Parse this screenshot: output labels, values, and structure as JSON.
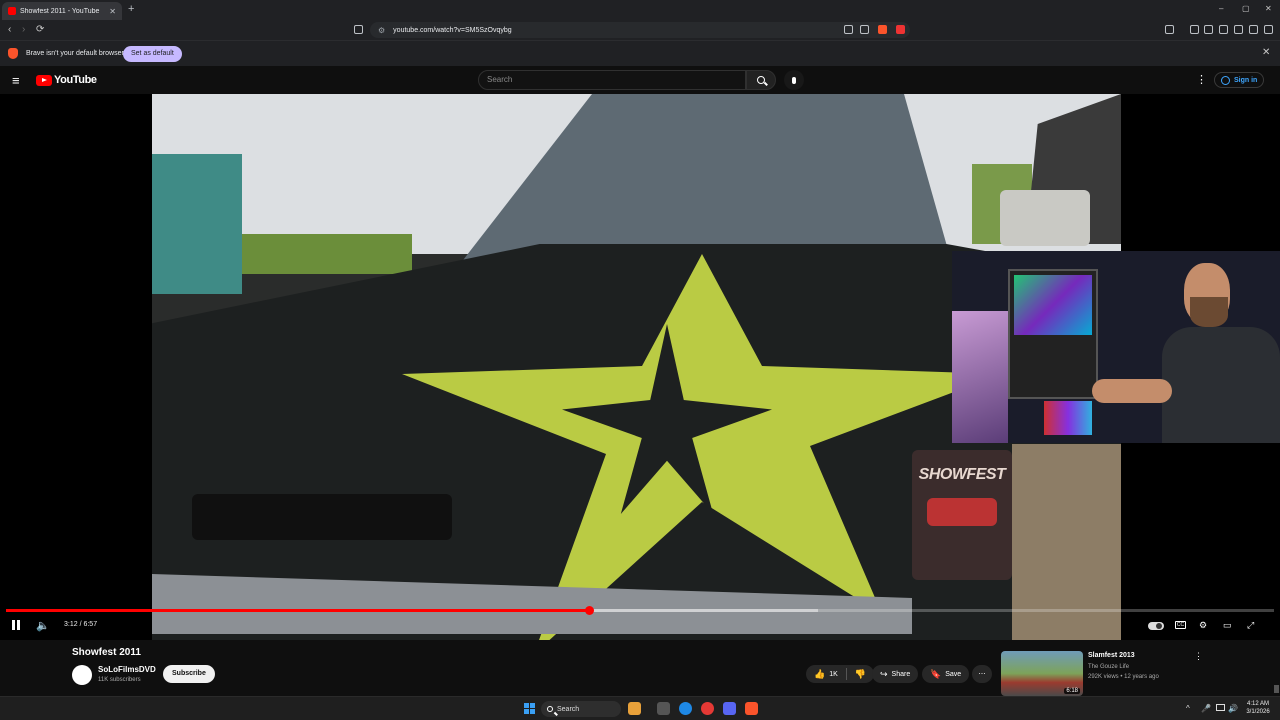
{
  "browser": {
    "tab_title": "Showfest 2011 - YouTube",
    "tab_close": "✕",
    "new_tab": "+",
    "url": "youtube.com/watch?v=SM5SzOvqybg",
    "window_controls": [
      "–",
      "▢",
      "✕"
    ],
    "nav_back": "‹",
    "nav_forward": "›",
    "nav_reload": "⟳",
    "infobar_message": "Brave isn't your default browser",
    "infobar_button": "Set as default",
    "infobar_close": "✕"
  },
  "youtube": {
    "menu_icon": "≡",
    "logo_text": "YouTube",
    "search_placeholder": "Search",
    "more_icon": "⋮",
    "signin_label": "Sign in"
  },
  "player": {
    "current_time": "3:12",
    "duration": "6:57",
    "timecode": "3:12 / 6:57",
    "progress_fraction": 0.46,
    "buffered_fraction": 0.64,
    "overlay_text": "SHOWFEST",
    "vol_icon": "🔈",
    "cc_label": "CC",
    "settings_icon": "⚙",
    "theater_icon": "▭",
    "fullscreen_icon": "⤢"
  },
  "video": {
    "title": "Showfest 2011",
    "channel_name": "SoLoFilmsDVD",
    "subscribers": "11K subscribers",
    "subscribe_label": "Subscribe",
    "like_icon": "👍",
    "like_count": "1K",
    "dislike_icon": "👎",
    "share_icon": "↪",
    "share_label": "Share",
    "save_icon": "🔖",
    "save_label": "Save",
    "more_icon": "⋯"
  },
  "recommended": {
    "title": "Slamfest 2013",
    "channel": "The Gouze Life",
    "meta": "292K views • 12 years ago",
    "duration": "6:18",
    "more_icon": "⋮"
  },
  "taskbar": {
    "search_label": "Search",
    "time": "4:12 AM",
    "date": "3/1/2026",
    "tray_icons": [
      "^",
      "🎤",
      "🔊"
    ]
  },
  "colors": {
    "brand_red": "#ff0000",
    "link_blue": "#3ea6ff",
    "infobar_button": "#c6b9ff",
    "brave_orange": "#fb542b"
  }
}
